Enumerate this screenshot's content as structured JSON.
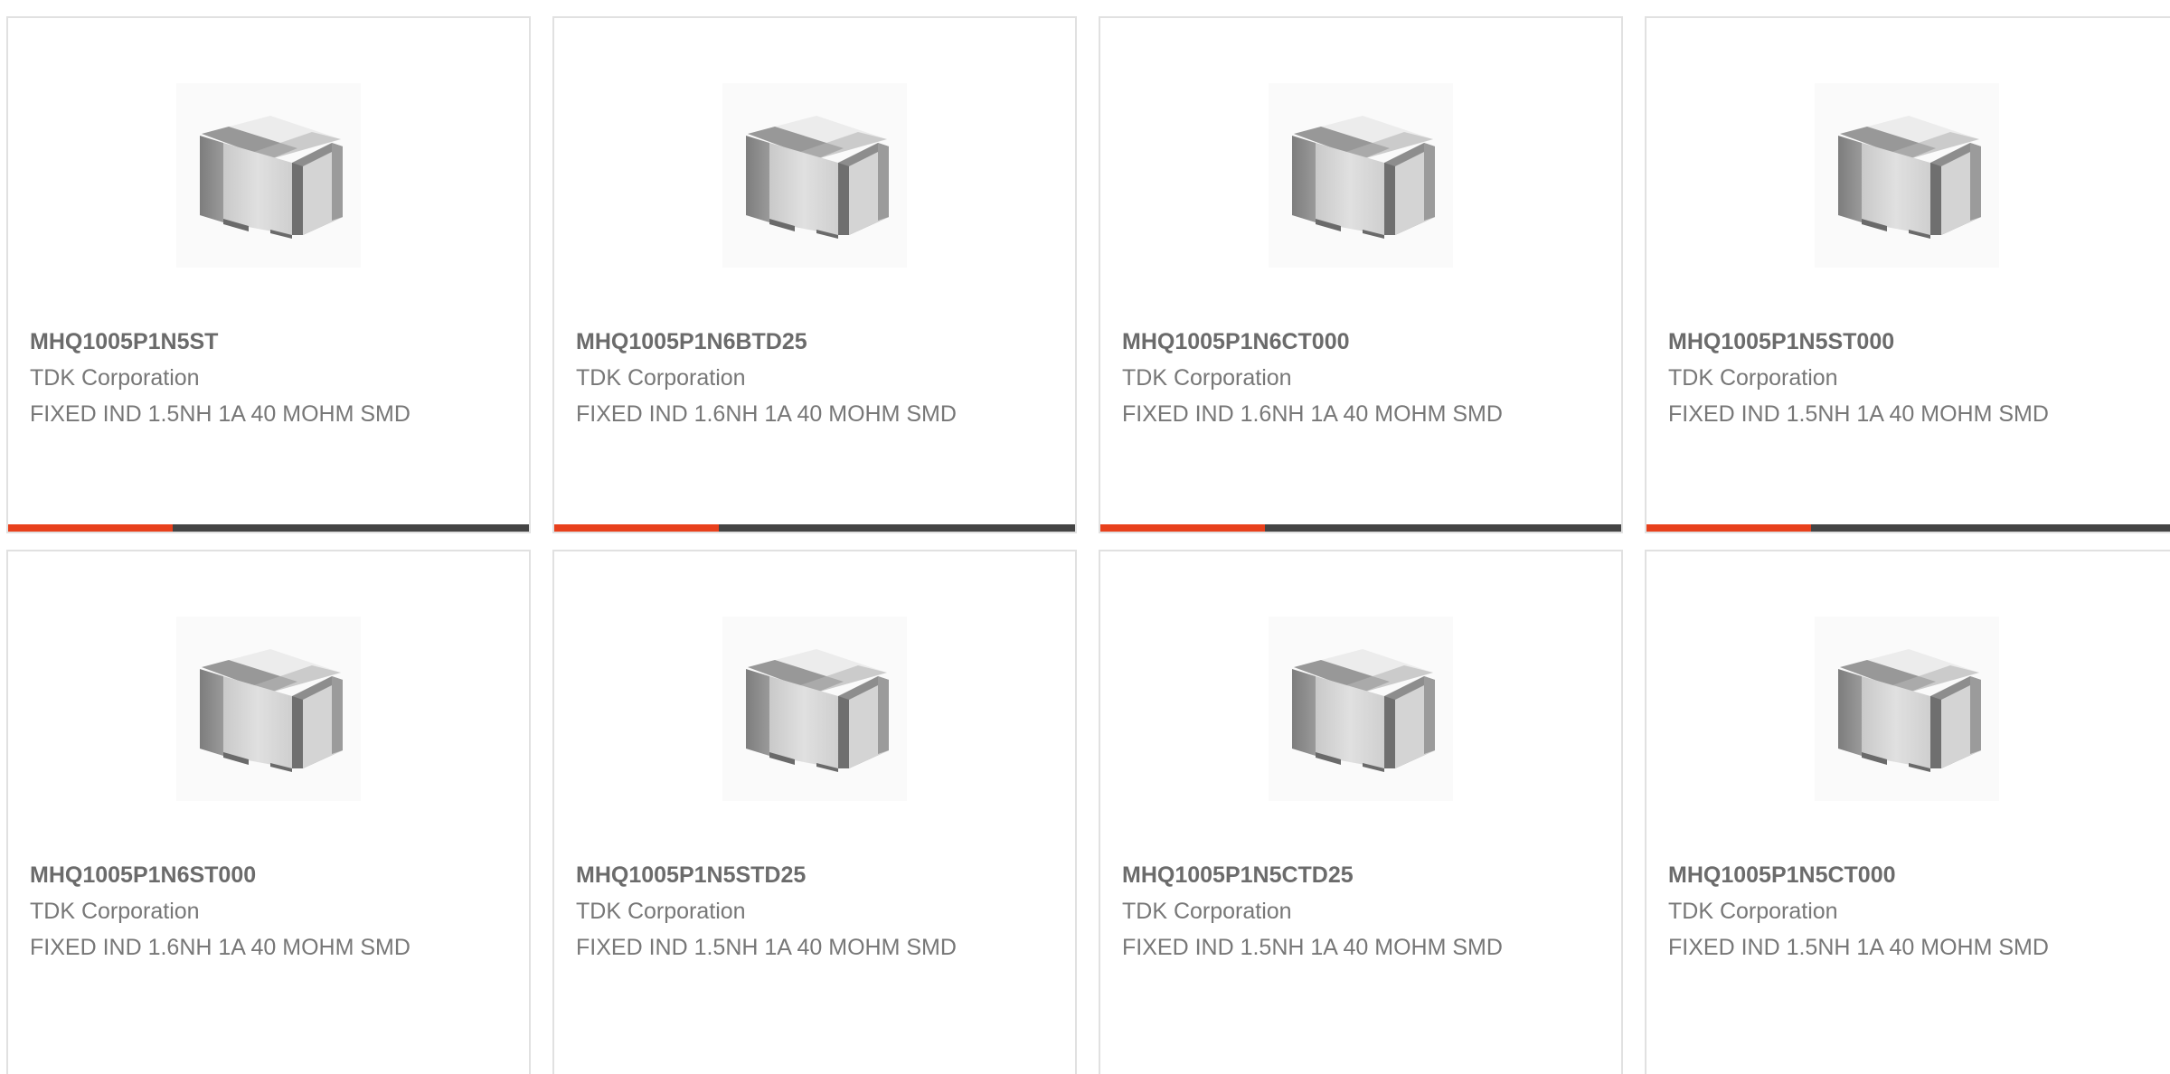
{
  "colors": {
    "accent": "#e8401c",
    "bar_base": "#444444",
    "part_number": "#6b6b6b",
    "text": "#777777",
    "card_border": "#e1e1e1"
  },
  "products": [
    {
      "part_number": "MHQ1005P1N5ST",
      "manufacturer": "TDK Corporation",
      "description": "FIXED IND 1.5NH 1A 40 MOHM SMD",
      "image": "smd-inductor-chip-image"
    },
    {
      "part_number": "MHQ1005P1N6BTD25",
      "manufacturer": "TDK Corporation",
      "description": "FIXED IND 1.6NH 1A 40 MOHM SMD",
      "image": "smd-inductor-chip-image"
    },
    {
      "part_number": "MHQ1005P1N6CT000",
      "manufacturer": "TDK Corporation",
      "description": "FIXED IND 1.6NH 1A 40 MOHM SMD",
      "image": "smd-inductor-chip-image"
    },
    {
      "part_number": "MHQ1005P1N5ST000",
      "manufacturer": "TDK Corporation",
      "description": "FIXED IND 1.5NH 1A 40 MOHM SMD",
      "image": "smd-inductor-chip-image"
    },
    {
      "part_number": "MHQ1005P1N6ST000",
      "manufacturer": "TDK Corporation",
      "description": "FIXED IND 1.6NH 1A 40 MOHM SMD",
      "image": "smd-inductor-chip-image"
    },
    {
      "part_number": "MHQ1005P1N5STD25",
      "manufacturer": "TDK Corporation",
      "description": "FIXED IND 1.5NH 1A 40 MOHM SMD",
      "image": "smd-inductor-chip-image"
    },
    {
      "part_number": "MHQ1005P1N5CTD25",
      "manufacturer": "TDK Corporation",
      "description": "FIXED IND 1.5NH 1A 40 MOHM SMD",
      "image": "smd-inductor-chip-image"
    },
    {
      "part_number": "MHQ1005P1N5CT000",
      "manufacturer": "TDK Corporation",
      "description": "FIXED IND 1.5NH 1A 40 MOHM SMD",
      "image": "smd-inductor-chip-image"
    }
  ]
}
